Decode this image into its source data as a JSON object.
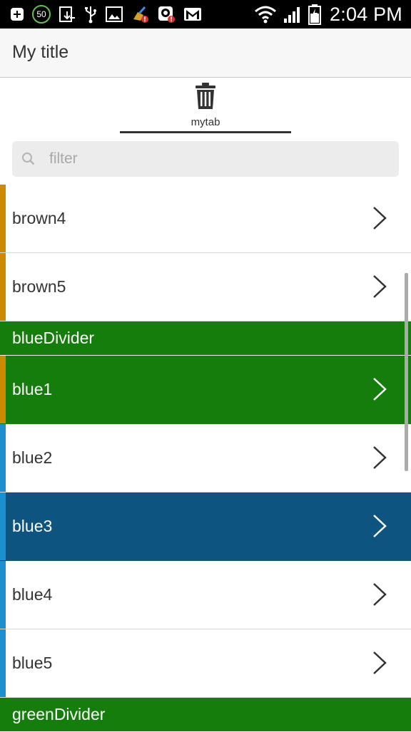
{
  "status_bar": {
    "time": "2:04 PM",
    "battery_circle": "50",
    "icons_left": [
      "add-icon",
      "battery-circle-icon",
      "download-icon",
      "usb-icon",
      "image-icon",
      "cleaner-alert-icon",
      "app-alert-icon",
      "gmail-icon"
    ],
    "icons_right": [
      "wifi-icon",
      "signal-icon",
      "battery-icon"
    ]
  },
  "header": {
    "title": "My title"
  },
  "tabs": [
    {
      "label": "mytab",
      "icon": "trash-icon"
    }
  ],
  "filter": {
    "placeholder": "filter",
    "value": ""
  },
  "list": [
    {
      "type": "item",
      "label": "brown4",
      "bar_color": "#cc8a00",
      "selected": false
    },
    {
      "type": "item",
      "label": "brown5",
      "bar_color": "#cc8a00",
      "selected": false
    },
    {
      "type": "divider",
      "label": "blueDivider"
    },
    {
      "type": "item",
      "label": "blue1",
      "bar_color": "#cc8a00",
      "selected": true,
      "highlight": "green"
    },
    {
      "type": "item",
      "label": "blue2",
      "bar_color": "#1b8fd0",
      "selected": false
    },
    {
      "type": "item",
      "label": "blue3",
      "bar_color": "#1b8fd0",
      "selected": true,
      "highlight": "blue"
    },
    {
      "type": "item",
      "label": "blue4",
      "bar_color": "#1b8fd0",
      "selected": false
    },
    {
      "type": "item",
      "label": "blue5",
      "bar_color": "#1b8fd0",
      "selected": false
    },
    {
      "type": "divider",
      "label": "greenDivider"
    }
  ],
  "colors": {
    "divider_bg": "#157d0c",
    "selected_green": "#157d0c",
    "selected_blue": "#0d5580",
    "brown_bar": "#cc8a00",
    "blue_bar": "#1b8fd0"
  }
}
